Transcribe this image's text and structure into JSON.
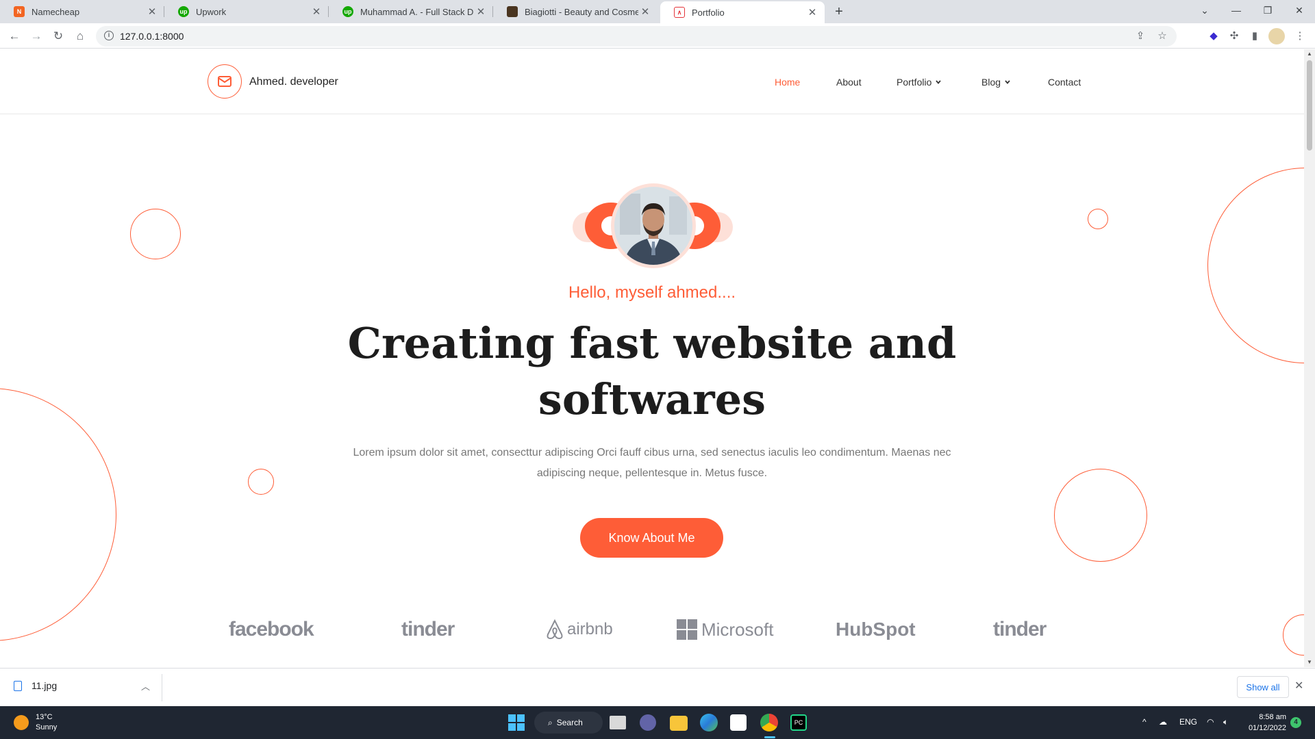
{
  "browser": {
    "tabs": [
      {
        "title": "Namecheap",
        "favicon": "namecheap-icon",
        "color": "#f26522"
      },
      {
        "title": "Upwork",
        "favicon": "upwork-icon",
        "color": "#14a800"
      },
      {
        "title": "Muhammad A. - Full Stack Devel",
        "favicon": "upwork-icon",
        "color": "#14a800"
      },
      {
        "title": "Biagiotti - Beauty and Cosmetics",
        "favicon": "biagiotti-icon",
        "color": "#4a3520"
      },
      {
        "title": "Portfolio",
        "favicon": "portfolio-icon",
        "color": "#e4343a"
      }
    ],
    "url": "127.0.0.1:8000"
  },
  "site": {
    "brand": "Ahmed. developer",
    "nav": [
      "Home",
      "About",
      "Portfolio",
      "Blog",
      "Contact"
    ],
    "accent": "#fe5d37"
  },
  "hero": {
    "greeting": "Hello, myself ahmed....",
    "headline_line1": "Creating fast website and",
    "headline_line2": "softwares",
    "lead": "Lorem ipsum dolor sit amet, consecttur adipiscing Orci fauff cibus urna, sed senectus iaculis leo condimentum. Maenas nec adipiscing neque, pellentesque in. Metus fusce.",
    "cta": "Know About Me"
  },
  "clients": [
    "facebook",
    "tinder",
    "airbnb",
    "Microsoft",
    "HubSpot",
    "tinder"
  ],
  "downloads": {
    "file": "11.jpg",
    "show_all": "Show all"
  },
  "taskbar": {
    "temperature": "13°C",
    "weather": "Sunny",
    "search": "Search",
    "language": "ENG",
    "time": "8:58 am",
    "date": "01/12/2022",
    "notifications": "4"
  }
}
